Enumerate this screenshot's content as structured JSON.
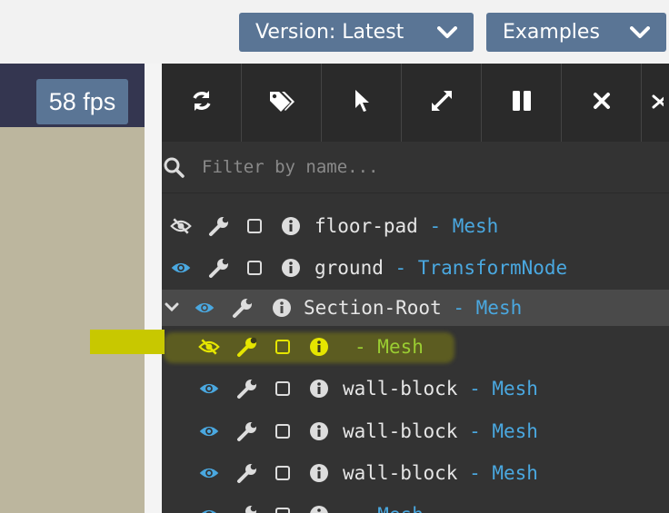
{
  "topbar": {
    "version_label": "Version: Latest",
    "examples_label": "Examples"
  },
  "scene": {
    "fps_label": "58 fps"
  },
  "inspector": {
    "filter_placeholder": "Filter by name...",
    "tools": [
      "refresh",
      "tags",
      "pointer",
      "expand",
      "pause",
      "close",
      "more"
    ],
    "rows": [
      {
        "name": "floor-pad",
        "type": "Mesh",
        "visible": false
      },
      {
        "name": "ground",
        "type": "TransformNode",
        "visible": true
      },
      {
        "name": "Section-Root",
        "type": "Mesh",
        "visible": true,
        "expanded": true
      },
      {
        "name": "",
        "type": "Mesh",
        "visible": false
      },
      {
        "name": "wall-block",
        "type": "Mesh",
        "visible": true
      },
      {
        "name": "wall-block",
        "type": "Mesh",
        "visible": true
      },
      {
        "name": "wall-block",
        "type": "Mesh",
        "visible": true
      },
      {
        "name": "",
        "type": "Mesh",
        "visible": true
      }
    ]
  },
  "colors": {
    "accent": "#5a7595",
    "type_text": "#4aa8e0",
    "highlight": "#c8c800",
    "highlight_text": "#9acd32"
  }
}
